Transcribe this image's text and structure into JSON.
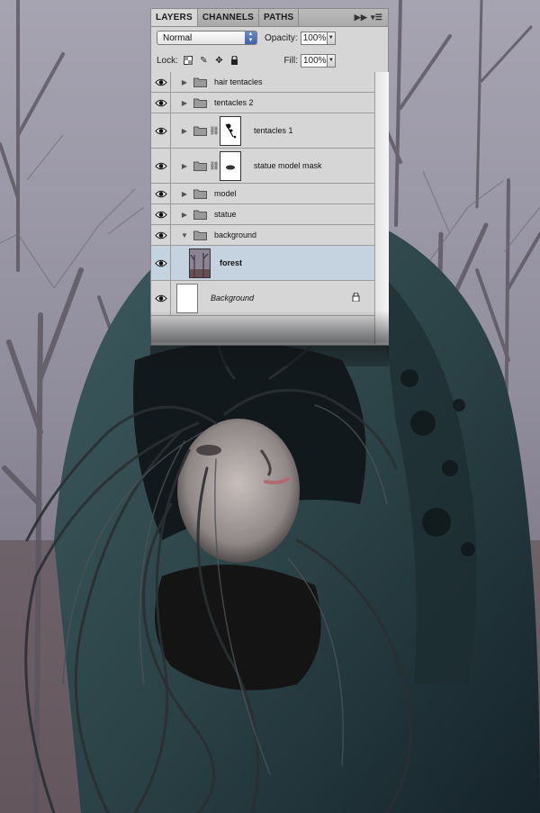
{
  "panel": {
    "tabs": [
      {
        "label": "LAYERS",
        "active": true
      },
      {
        "label": "CHANNELS",
        "active": false
      },
      {
        "label": "PATHS",
        "active": false
      }
    ],
    "menu_icons": [
      "collapse-arrows-icon",
      "panel-menu-icon"
    ],
    "blend_mode": "Normal",
    "opacity_label": "Opacity:",
    "opacity_value": "100%",
    "lock_label": "Lock:",
    "fill_label": "Fill:",
    "fill_value": "100%"
  },
  "layers": [
    {
      "name": "hair tentacles",
      "type": "group",
      "expanded": false,
      "mask": false
    },
    {
      "name": "tentacles 2",
      "type": "group",
      "expanded": false,
      "mask": false
    },
    {
      "name": "tentacles 1",
      "type": "group",
      "expanded": false,
      "mask": true
    },
    {
      "name": "statue model mask",
      "type": "group",
      "expanded": false,
      "mask": true
    },
    {
      "name": "model",
      "type": "group",
      "expanded": false,
      "mask": false
    },
    {
      "name": "statue",
      "type": "group",
      "expanded": false,
      "mask": false
    },
    {
      "name": "background",
      "type": "group",
      "expanded": true,
      "mask": false
    },
    {
      "name": "forest",
      "type": "layer",
      "selected": true
    },
    {
      "name": "Background",
      "type": "background",
      "locked": true
    }
  ],
  "colors": {
    "panel_bg": "#d6d6d6",
    "selected_row": "#c5d2df",
    "cloak": "#2f4a4f",
    "fog": "#8e8c9a"
  }
}
